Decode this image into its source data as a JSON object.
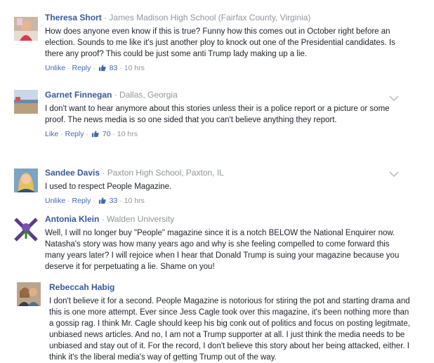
{
  "colors": {
    "name": "#365899",
    "link": "#4267b2",
    "meta": "#90949c",
    "text": "#1d2129"
  },
  "comments": [
    {
      "name": "Theresa Short",
      "affiliation": "James Madison High School (Fairfax County, Virginia)",
      "text": "How does anyone even know if this is true? Funny how this comes out in October right before an election. Sounds to me like it's just another ploy to knock out one of the Presidential candidates. Is there any proof? This could be just some anti Trump lady making up a lie.",
      "unlike": "Unlike",
      "reply": "Reply",
      "likes": "83",
      "time": "10 hrs",
      "avatar_icon": "profile-photo"
    },
    {
      "name": "Garnet Finnegan",
      "affiliation": "Dallas, Georgia",
      "text": "I don't want to hear anymore about this stories unless their is a police report or a picture or some proof. The news media is so one sided that you can't believe anything they report.",
      "like": "Like",
      "reply": "Reply",
      "likes": "70",
      "time": "10 hrs",
      "avatar_icon": "landscape-photo"
    },
    {
      "name": "Sandee Davis",
      "affiliation": "Paxton High School, Paxton, IL",
      "text": "I used to respect People Magazine.",
      "unlike": "Unlike",
      "reply": "Reply",
      "likes": "33",
      "time": "10 hrs",
      "avatar_icon": "profile-photo"
    },
    {
      "name": "Antonia Klein",
      "affiliation": "Walden University",
      "text": "Well, I will no longer buy \"People\" magazine since it is a notch BELOW the National Enquirer now. Natasha's story was how many years ago and why is she feeling compelled to come forward this many years later? I will rejoice when I hear that Donald Trump is suing your magazine because you deserve it for perpetuating a lie. Shame on you!",
      "avatar_icon": "thistle-emblem"
    },
    {
      "name": "Rebeccah Habig",
      "text": "I don't believe it for a second. People Magazine is notorious for stiring the pot and starting drama and this is one more attempt. Ever since Jess Cagle took over this magazine, it's been nothing more than a gossip rag. I think Mr. Cagle should keep his big conk out of politics and focus on posting legitmate, unbiased news articles. And no, I am not a Trump supporter at all. I just think the media needs to be unbiased and stay out of it. For the record, I don't believe this story about her being attacked, either. I think it's the liberal media's way of getting Trump out of the way.",
      "avatar_icon": "couple-photo"
    }
  ]
}
